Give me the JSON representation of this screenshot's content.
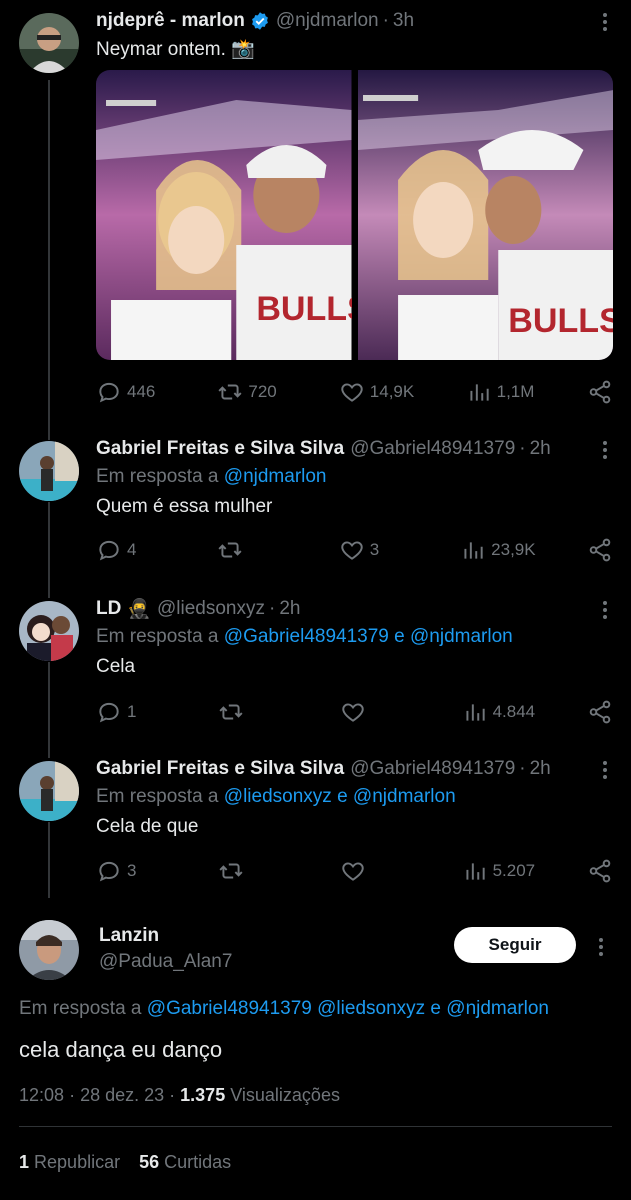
{
  "tweets": [
    {
      "name": "njdeprê - marlon",
      "handle": "@njdmarlon",
      "time": "3h",
      "text": "Neymar ontem. 📸",
      "replies": "446",
      "retweets": "720",
      "likes": "14,9K",
      "views": "1,1M"
    },
    {
      "name": "Gabriel Freitas e Silva Silva",
      "handle": "@Gabriel48941379",
      "time": "2h",
      "reply_prefix": "Em resposta a",
      "reply_to": [
        "@njdmarlon"
      ],
      "text": "Quem é essa mulher",
      "replies": "4",
      "retweets": "",
      "likes": "3",
      "views": "23,9K"
    },
    {
      "name": "LD",
      "emoji": "🥷",
      "handle": "@liedsonxyz",
      "time": "2h",
      "reply_prefix": "Em resposta a",
      "reply_to": [
        "@Gabriel48941379",
        "@njdmarlon"
      ],
      "reply_joiner": "e",
      "text": "Cela",
      "replies": "1",
      "retweets": "",
      "likes": "",
      "views": "4.844"
    },
    {
      "name": "Gabriel Freitas e Silva Silva",
      "handle": "@Gabriel48941379",
      "time": "2h",
      "reply_prefix": "Em resposta a",
      "reply_to": [
        "@liedsonxyz",
        "@njdmarlon"
      ],
      "reply_joiner": "e",
      "text": "Cela de que",
      "replies": "3",
      "retweets": "",
      "likes": "",
      "views": "5.207"
    }
  ],
  "main": {
    "name": "Lanzin",
    "handle": "@Padua_Alan7",
    "follow_label": "Seguir",
    "reply_prefix": "Em resposta a",
    "reply_to": [
      "@Gabriel48941379",
      "@liedsonxyz",
      "@njdmarlon"
    ],
    "reply_joiner": "e",
    "text": "cela dança eu danço",
    "time": "12:08",
    "date": "28 dez. 23",
    "views_count": "1.375",
    "views_label": "Visualizações",
    "reposts_count": "1",
    "reposts_label": "Republicar",
    "likes_count": "56",
    "likes_label": "Curtidas"
  },
  "colors": {
    "background": "#000000",
    "text": "#e7e9ea",
    "muted": "#71767b",
    "link": "#1d9bf0",
    "verified": "#1d9bf0"
  }
}
